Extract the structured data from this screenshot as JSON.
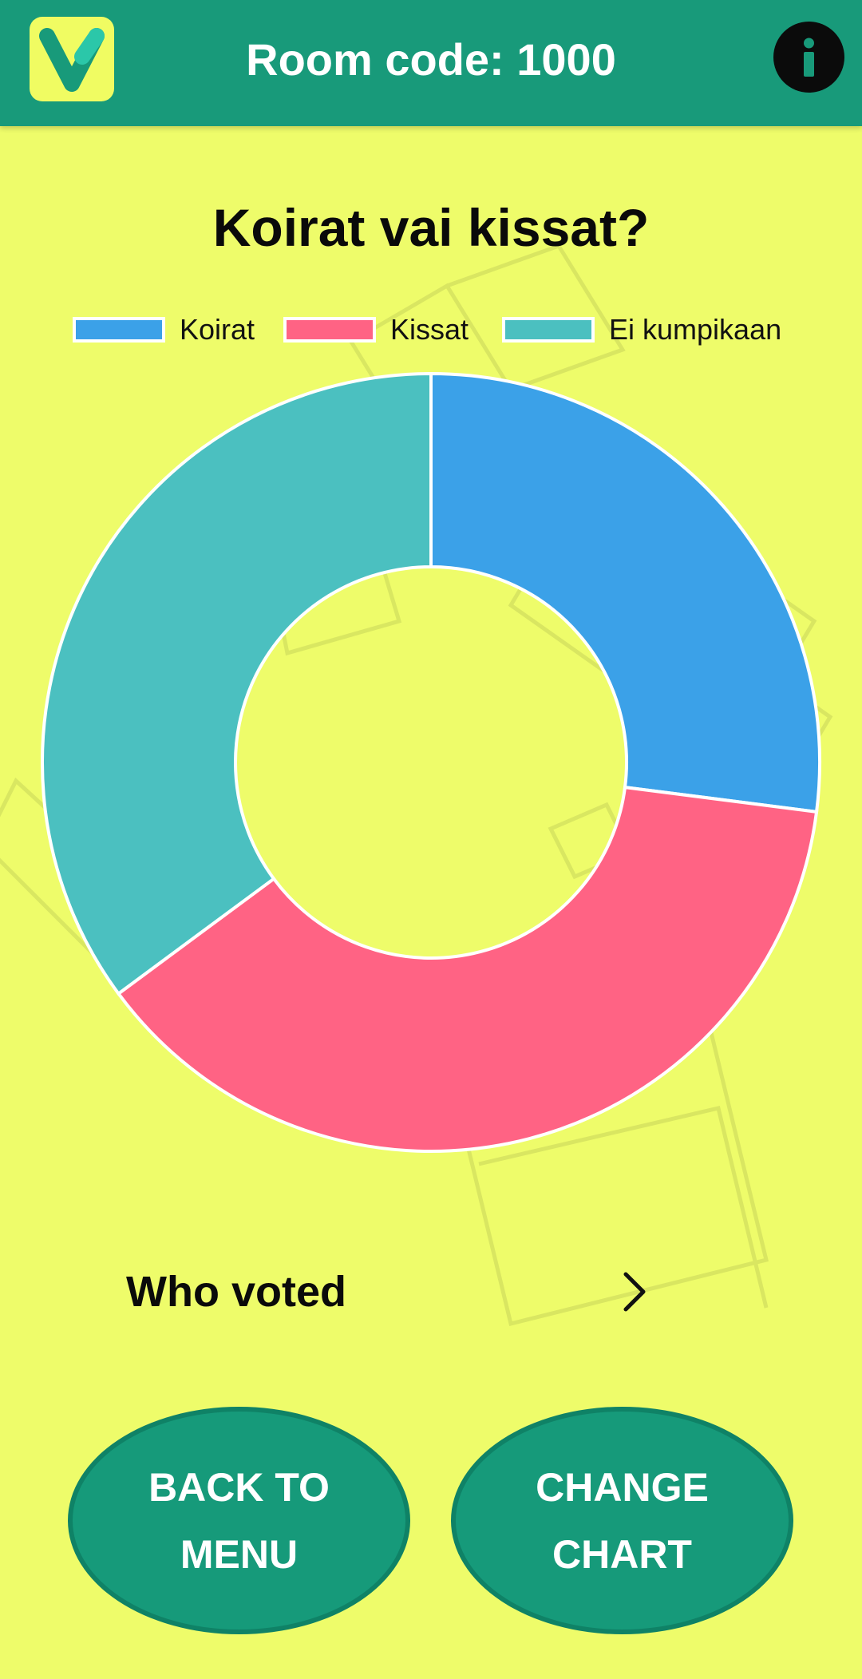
{
  "header": {
    "logo_letter": "V",
    "room_code": "Room code: 1000",
    "info_icon": "info-icon"
  },
  "colors": {
    "header": "#189a7a",
    "background": "#eefc6a",
    "button": "#169a7a"
  },
  "chart_data": {
    "type": "pie",
    "variant": "donut",
    "title": "Koirat vai kissat?",
    "legend_position": "top",
    "series": [
      {
        "name": "Koirat",
        "value": 1,
        "color": "#3ba1e8"
      },
      {
        "name": "Kissat",
        "value": 1.4,
        "color": "#ff6384"
      },
      {
        "name": "Ei kumpikaan",
        "value": 1.3,
        "color": "#4bc0c0"
      }
    ]
  },
  "who_voted": {
    "label": "Who voted",
    "icon": "chevron-right-icon"
  },
  "buttons": {
    "back_to_menu": "BACK TO MENU",
    "change_chart": "CHANGE CHART"
  }
}
